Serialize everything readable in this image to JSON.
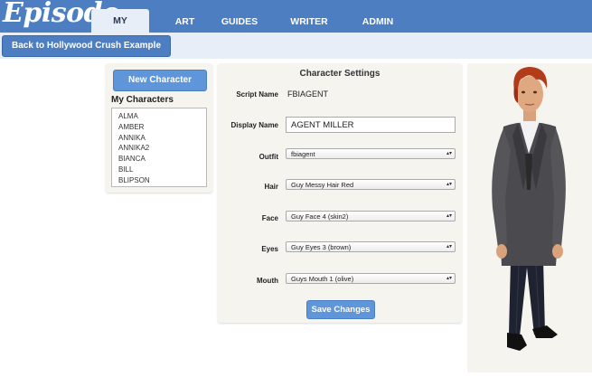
{
  "app": {
    "logo": "Episode"
  },
  "nav": {
    "tabs": [
      {
        "label": "MY STORIES",
        "active": true
      },
      {
        "label": "ART CATALOG",
        "active": false
      },
      {
        "label": "GUIDES",
        "active": false
      },
      {
        "label": "WRITER COMMUNITY",
        "active": false
      },
      {
        "label": "ADMIN",
        "active": false
      }
    ]
  },
  "subbar": {
    "back_label": "Back to Hollywood Crush Example Script"
  },
  "sidebar": {
    "new_character_label": "New Character",
    "heading": "My Characters",
    "characters": [
      "ALMA",
      "AMBER",
      "ANNIKA",
      "ANNIKA2",
      "BIANCA",
      "BILL",
      "BLIPSON"
    ]
  },
  "settings": {
    "title": "Character Settings",
    "script_name_label": "Script Name",
    "script_name_value": "FBIAGENT",
    "display_name_label": "Display Name",
    "display_name_value": "AGENT MILLER",
    "outfit_label": "Outfit",
    "outfit_value": "fbiagent",
    "hair_label": "Hair",
    "hair_value": "Guy Messy Hair Red",
    "face_label": "Face",
    "face_value": "Guy Face 4 (skin2)",
    "eyes_label": "Eyes",
    "eyes_value": "Guy Eyes 3 (brown)",
    "mouth_label": "Mouth",
    "mouth_value": "Guys Mouth 1 (olive)",
    "save_label": "Save Changes"
  },
  "colors": {
    "brand_blue": "#4d7ec2",
    "button_blue": "#5f95d9",
    "panel_bg": "#f5f4ef",
    "hair_red": "#b23b1a"
  }
}
